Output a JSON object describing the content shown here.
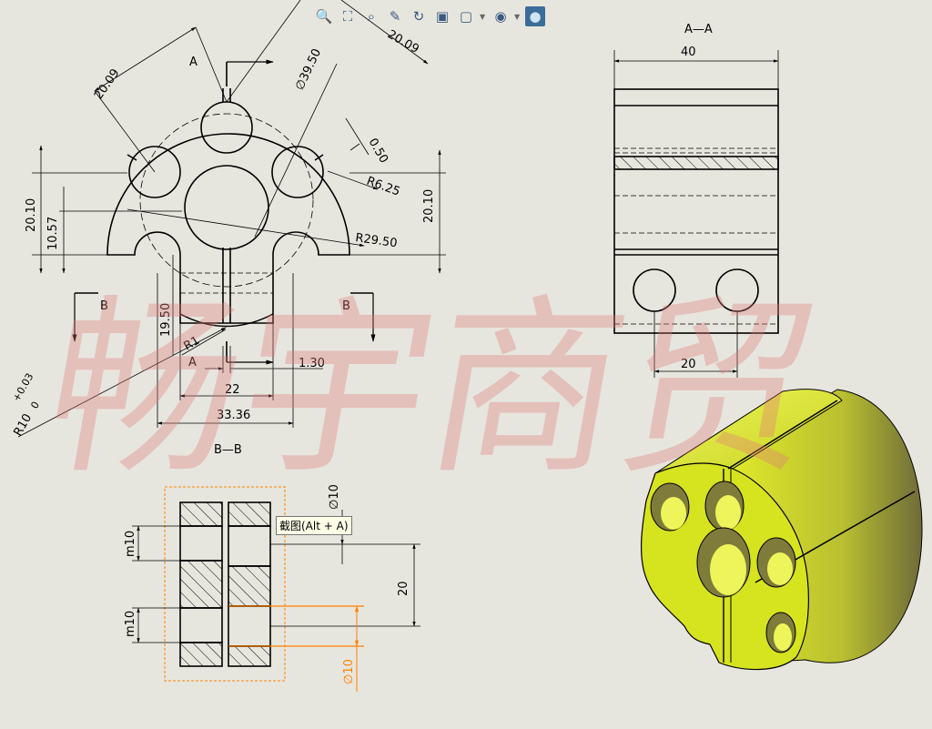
{
  "toolbar": {
    "buttons": [
      "zoom-to-fit-icon",
      "zoom-to-area-icon",
      "zoom-in-out-icon",
      "pan-icon",
      "rotate-icon",
      "view-orientation-icon",
      "display-style-icon",
      "hide-show-icon",
      "appearance-icon"
    ]
  },
  "tooltip": "截图(Alt + A)",
  "watermark": "畅宇商贸",
  "front_view": {
    "dims": {
      "d1": "20.09",
      "d2": "20.09",
      "dia": "∅39.50",
      "gap": "0.50",
      "r625": "R6.25",
      "r2950": "R29.50",
      "h2010_left": "20.10",
      "h1057": "10.57",
      "h2010_right": "20.10",
      "h1950": "19.50",
      "r1": "R1",
      "w130": "1.30",
      "w22": "22",
      "w3336": "33.36",
      "r10_base": "R10",
      "r10_tol_up": "+0.03",
      "r10_tol_low": "0"
    },
    "labels": {
      "a_top": "A",
      "a_bottom": "A",
      "b_left": "B",
      "b_right": "B"
    }
  },
  "section_aa": {
    "title": "A—A",
    "dims": {
      "width": "40",
      "holes": "20"
    }
  },
  "section_bb": {
    "title": "B—B",
    "dims": {
      "m10_top": "m10",
      "m10_bot": "m10",
      "dia_top": "∅10",
      "dia_bot": "∅10",
      "h20": "20"
    }
  },
  "colors": {
    "line": "#000000",
    "part_yellow": "#d6e31f",
    "part_shadow": "#7f7b3a",
    "highlight": "#ff8000",
    "watermark": "#e8a0a0"
  }
}
